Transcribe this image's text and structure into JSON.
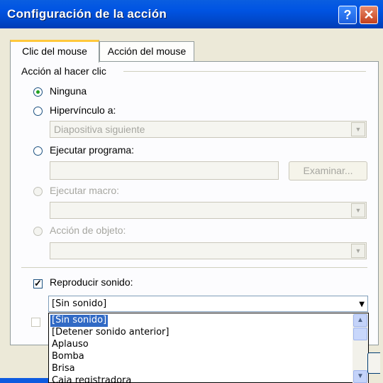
{
  "window": {
    "title": "Configuración de la acción",
    "help_label": "?",
    "close_label": "✕"
  },
  "tabs": [
    {
      "label": "Clic del mouse",
      "active": true
    },
    {
      "label": "Acción del mouse",
      "active": false
    }
  ],
  "group": {
    "label": "Acción al hacer clic",
    "options": [
      {
        "label": "Ninguna",
        "selected": true,
        "enabled": true
      },
      {
        "label": "Hipervínculo a:",
        "selected": false,
        "enabled": true
      },
      {
        "label": "Ejecutar programa:",
        "selected": false,
        "enabled": true
      },
      {
        "label": "Ejecutar macro:",
        "selected": false,
        "enabled": false
      },
      {
        "label": "Acción de objeto:",
        "selected": false,
        "enabled": false
      }
    ],
    "hyperlink_value": "Diapositiva siguiente",
    "program_value": "",
    "browse_label": "Examinar..."
  },
  "sound": {
    "checkbox_label": "Reproducir sonido:",
    "checked": true,
    "selected_value": "[Sin sonido]",
    "options": [
      "[Sin sonido]",
      "[Detener sonido anterior]",
      "Aplauso",
      "Bomba",
      "Brisa",
      "Caja registradora"
    ],
    "highlighted_index": 0
  },
  "colors": {
    "title_bar": "#0054e3",
    "dialog_bg": "#ece9d8",
    "selection": "#316ac5",
    "tab_highlight": "#ffc83c"
  }
}
